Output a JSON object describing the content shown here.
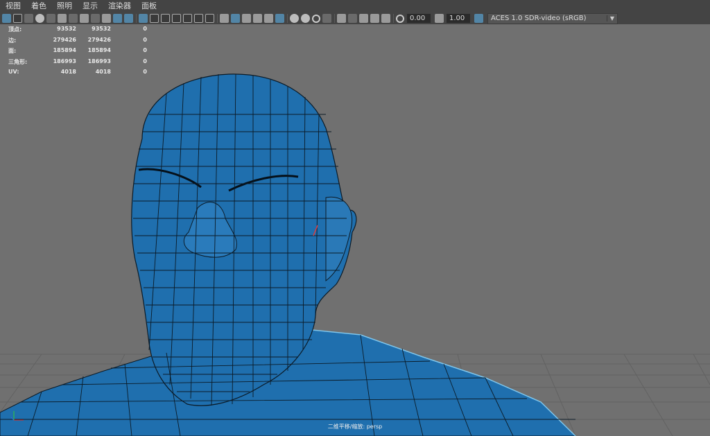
{
  "menu": [
    "视图",
    "着色",
    "照明",
    "显示",
    "渲染器",
    "面板"
  ],
  "toolbar": {
    "exposure_value": "0.00",
    "gamma_value": "1.00",
    "color_space": "ACES 1.0 SDR-video (sRGB)"
  },
  "hud": {
    "rows": [
      {
        "label": "顶点:",
        "v1": "93532",
        "v2": "93532",
        "v3": "0"
      },
      {
        "label": "边:",
        "v1": "279426",
        "v2": "279426",
        "v3": "0"
      },
      {
        "label": "面:",
        "v1": "185894",
        "v2": "185894",
        "v3": "0"
      },
      {
        "label": "三角形:",
        "v1": "186993",
        "v2": "186993",
        "v3": "0"
      },
      {
        "label": "UV:",
        "v1": "4018",
        "v2": "4018",
        "v3": "0"
      }
    ]
  },
  "camera_label": "二维平移/缩放: persp",
  "colors": {
    "mesh_fill": "#1f6fae",
    "wire": "#0b1a26",
    "viewport_bg": "#707070",
    "highlight": "#5285a6"
  }
}
